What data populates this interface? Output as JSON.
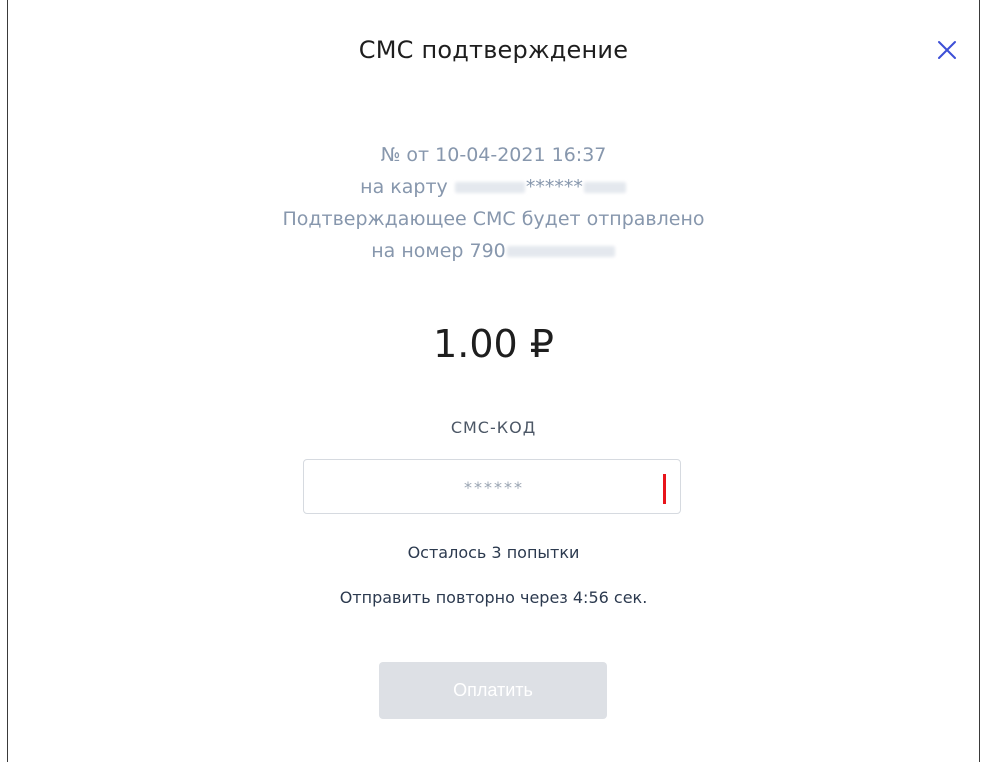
{
  "modal": {
    "title": "СМС подтверждение",
    "close_icon": "close-icon",
    "accent_color": "#3d4fd6"
  },
  "info": {
    "line1": "№ от 10-04-2021 16:37",
    "line2_prefix": "на карту ",
    "line2_masked": "******",
    "line3": "Подтверждающее СМС будет отправлено",
    "line4_prefix": "на номер 790"
  },
  "amount": "1.00 ₽",
  "code": {
    "label": "СМС-КОД",
    "placeholder": "******",
    "value": ""
  },
  "attempts_text": "Осталось 3 попытки",
  "resend_text": "Отправить повторно через 4:56 сек.",
  "pay_button": {
    "label": "Оплатить",
    "disabled": true
  }
}
